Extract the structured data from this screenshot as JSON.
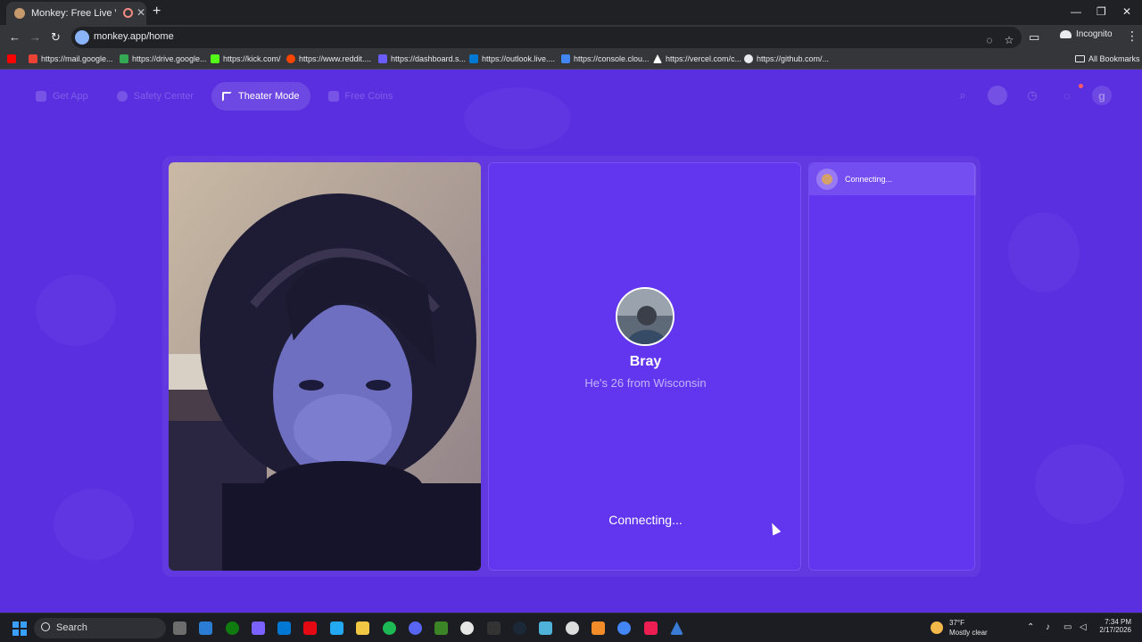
{
  "browser": {
    "tab_title": "Monkey: Free Live Video Ch",
    "url": "monkey.app/home",
    "incognito_label": "Incognito",
    "bookmarks": [
      {
        "label": "https://mail.google...",
        "color": "#ea4335"
      },
      {
        "label": "https://drive.google...",
        "color": "#34a853"
      },
      {
        "label": "https://kick.com/",
        "color": "#53fc18"
      },
      {
        "label": "https://www.reddit....",
        "color": "#ff4500"
      },
      {
        "label": "https://dashboard.s...",
        "color": "#6a5cff"
      },
      {
        "label": "https://outlook.live....",
        "color": "#0078d4"
      },
      {
        "label": "https://console.clou...",
        "color": "#4285f4"
      },
      {
        "label": "https://vercel.com/c...",
        "color": "#ffffff"
      },
      {
        "label": "https://github.com/...",
        "color": "#e8eaed"
      }
    ],
    "all_bookmarks_label": "All Bookmarks"
  },
  "nav": {
    "items": [
      {
        "label": "Get App",
        "icon": "phone-icon"
      },
      {
        "label": "Safety Center",
        "icon": "shield-icon"
      },
      {
        "label": "Theater Mode",
        "icon": "expand-icon",
        "active": true
      },
      {
        "label": "Free Coins",
        "icon": "coins-icon"
      }
    ],
    "right_icons": [
      "search-icon",
      "avatar-icon",
      "history-icon",
      "chat-icon",
      "profile-initial-icon"
    ],
    "profile_initial": "g"
  },
  "match": {
    "name": "Bray",
    "info": "He's 26 from Wisconsin",
    "status": "Connecting..."
  },
  "chat": {
    "status": "Connecting..."
  },
  "taskbar": {
    "search_label": "Search",
    "weather_temp": "37°F",
    "weather_desc": "Mostly clear",
    "time": "7:34 PM",
    "date": "2/17/2026"
  },
  "colors": {
    "page_bg": "#5a2fe0",
    "panel_bg": "#6136ee",
    "accent": "#ffffff"
  }
}
